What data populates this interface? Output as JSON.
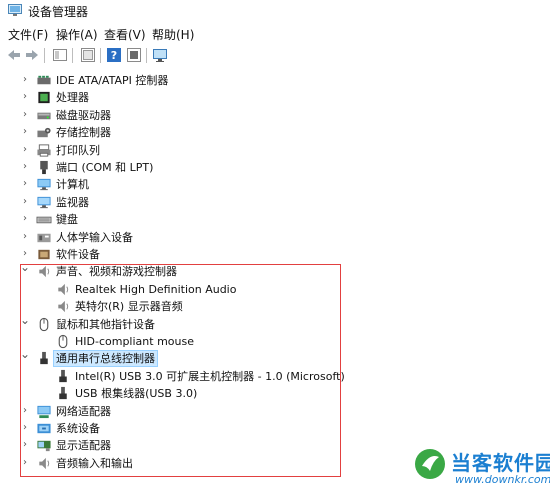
{
  "window": {
    "title": "设备管理器"
  },
  "menu": [
    {
      "label": "文件(F)"
    },
    {
      "label": "操作(A)"
    },
    {
      "label": "查看(V)"
    },
    {
      "label": "帮助(H)"
    }
  ],
  "toolbar": {
    "buttons": [
      "back-icon",
      "forward-icon",
      "properties-icon",
      "view-icon",
      "help-icon",
      "action-icon",
      "monitor-icon"
    ]
  },
  "tree": [
    {
      "label": "IDE ATA/ATAPI 控制器",
      "icon": "ide-controller-icon",
      "level": 0,
      "expanded": false
    },
    {
      "label": "处理器",
      "icon": "processor-icon",
      "level": 0,
      "expanded": false
    },
    {
      "label": "磁盘驱动器",
      "icon": "disk-drive-icon",
      "level": 0,
      "expanded": false
    },
    {
      "label": "存储控制器",
      "icon": "storage-controller-icon",
      "level": 0,
      "expanded": false
    },
    {
      "label": "打印队列",
      "icon": "printer-icon",
      "level": 0,
      "expanded": false
    },
    {
      "label": "端口 (COM 和 LPT)",
      "icon": "port-icon",
      "level": 0,
      "expanded": false
    },
    {
      "label": "计算机",
      "icon": "computer-icon",
      "level": 0,
      "expanded": false
    },
    {
      "label": "监视器",
      "icon": "monitor-icon",
      "level": 0,
      "expanded": false
    },
    {
      "label": "键盘",
      "icon": "keyboard-icon",
      "level": 0,
      "expanded": false
    },
    {
      "label": "人体学输入设备",
      "icon": "hid-icon",
      "level": 0,
      "expanded": false
    },
    {
      "label": "软件设备",
      "icon": "software-device-icon",
      "level": 0,
      "expanded": false
    },
    {
      "label": "声音、视频和游戏控制器",
      "icon": "speaker-icon",
      "level": 0,
      "expanded": true
    },
    {
      "label": "Realtek High Definition Audio",
      "icon": "speaker-icon",
      "level": 1
    },
    {
      "label": "英特尔(R) 显示器音频",
      "icon": "speaker-icon",
      "level": 1
    },
    {
      "label": "鼠标和其他指针设备",
      "icon": "mouse-icon",
      "level": 0,
      "expanded": true
    },
    {
      "label": "HID-compliant mouse",
      "icon": "mouse-icon",
      "level": 1
    },
    {
      "label": "通用串行总线控制器",
      "icon": "usb-icon",
      "level": 0,
      "expanded": true,
      "selected": true
    },
    {
      "label": "Intel(R) USB 3.0 可扩展主机控制器 - 1.0 (Microsoft)",
      "icon": "usb-icon",
      "level": 1
    },
    {
      "label": "USB 根集线器(USB 3.0)",
      "icon": "usb-icon",
      "level": 1
    },
    {
      "label": "网络适配器",
      "icon": "network-adapter-icon",
      "level": 0,
      "expanded": false
    },
    {
      "label": "系统设备",
      "icon": "system-device-icon",
      "level": 0,
      "expanded": false
    },
    {
      "label": "显示适配器",
      "icon": "display-adapter-icon",
      "level": 0,
      "expanded": false
    },
    {
      "label": "音频输入和输出",
      "icon": "speaker-icon",
      "level": 0,
      "expanded": false
    }
  ],
  "watermark": {
    "name": "当客软件园",
    "url": "www.downkr.com"
  }
}
